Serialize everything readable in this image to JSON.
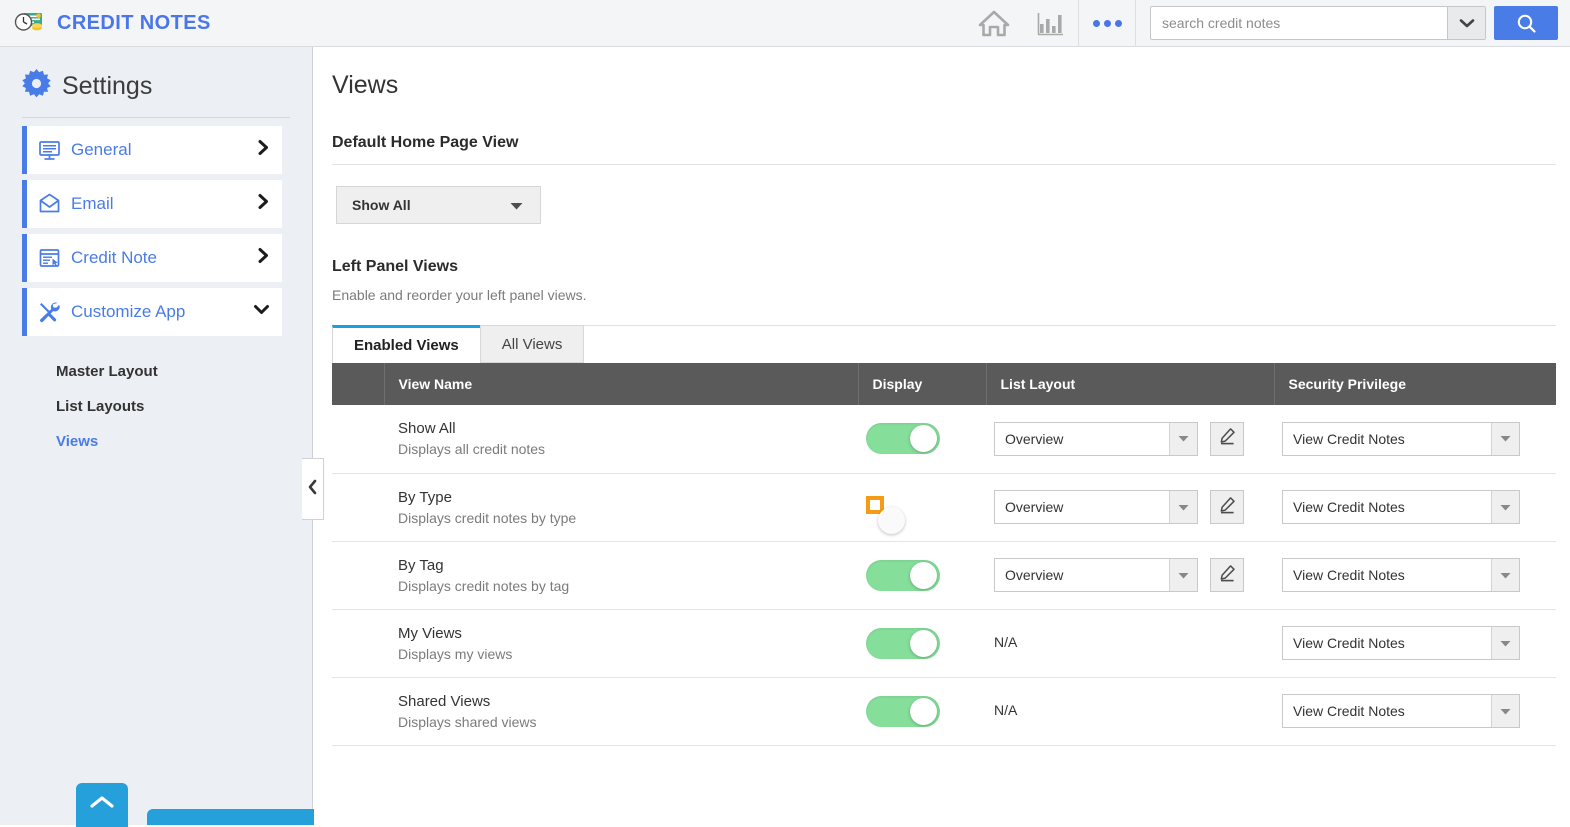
{
  "app": {
    "title": "CREDIT NOTES",
    "logo_icon": "credit-note-clock-money-icon",
    "brand_color": "#4a76e8"
  },
  "topbar": {
    "home_icon": "home-icon",
    "reports_icon": "bar-chart-icon",
    "more_icon": "more-dots-icon",
    "search": {
      "value": "",
      "placeholder": "search credit notes",
      "dropdown_icon": "chevron-down-icon",
      "button_icon": "search-icon",
      "button_color": "#4a7ce8"
    }
  },
  "sidebar": {
    "heading": "Settings",
    "heading_icon": "gear-icon",
    "items": [
      {
        "label": "General",
        "icon": "monitor-icon",
        "chevron": "chevron-right-icon"
      },
      {
        "label": "Email",
        "icon": "envelope-icon",
        "chevron": "chevron-right-icon"
      },
      {
        "label": "Credit Note",
        "icon": "document-window-icon",
        "chevron": "chevron-right-icon"
      },
      {
        "label": "Customize App",
        "icon": "tools-icon",
        "chevron": "chevron-down-icon"
      }
    ],
    "subitems": [
      {
        "label": "Master Layout",
        "active": false
      },
      {
        "label": "List Layouts",
        "active": false
      },
      {
        "label": "Views",
        "active": true
      }
    ],
    "scroll_top_icon": "chevron-up-icon",
    "collapse_icon": "chevron-left-icon",
    "accent_color": "#26a0da"
  },
  "main": {
    "page_title": "Views",
    "default_home_page_view": {
      "label": "Default Home Page View",
      "selected": "Show All",
      "dropdown_icon": "triangle-down-icon"
    },
    "left_panel_views": {
      "label": "Left Panel Views",
      "description": "Enable and reorder your left panel views.",
      "tabs": [
        {
          "label": "Enabled Views",
          "active": true
        },
        {
          "label": "All Views",
          "active": false
        }
      ],
      "table": {
        "columns": [
          "",
          "View Name",
          "Display",
          "List Layout",
          "Security Privilege"
        ],
        "rows": [
          {
            "name": "Show All",
            "description": "Displays all credit notes",
            "display_on": true,
            "list_layout": "Overview",
            "has_list_layout_select": true,
            "edit_icon": "pencil-edit-icon",
            "security_privilege": "View Credit Notes",
            "highlighted": false
          },
          {
            "name": "By Type",
            "description": "Displays credit notes by type",
            "display_on": false,
            "list_layout": "Overview",
            "has_list_layout_select": true,
            "edit_icon": "pencil-edit-icon",
            "security_privilege": "View Credit Notes",
            "highlighted": true
          },
          {
            "name": "By Tag",
            "description": "Displays credit notes by tag",
            "display_on": true,
            "list_layout": "Overview",
            "has_list_layout_select": true,
            "edit_icon": "pencil-edit-icon",
            "security_privilege": "View Credit Notes",
            "highlighted": false
          },
          {
            "name": "My Views",
            "description": "Displays my views",
            "display_on": true,
            "list_layout": "N/A",
            "has_list_layout_select": false,
            "edit_icon": "",
            "security_privilege": "View Credit Notes",
            "highlighted": false
          },
          {
            "name": "Shared Views",
            "description": "Displays shared views",
            "display_on": true,
            "list_layout": "N/A",
            "has_list_layout_select": false,
            "edit_icon": "",
            "security_privilege": "View Credit Notes",
            "highlighted": false
          }
        ]
      }
    }
  },
  "colors": {
    "toggle_on": "#85de9a",
    "toggle_off": "#ededed",
    "highlight_box": "#f59b16",
    "table_header": "#5a5a5a"
  }
}
